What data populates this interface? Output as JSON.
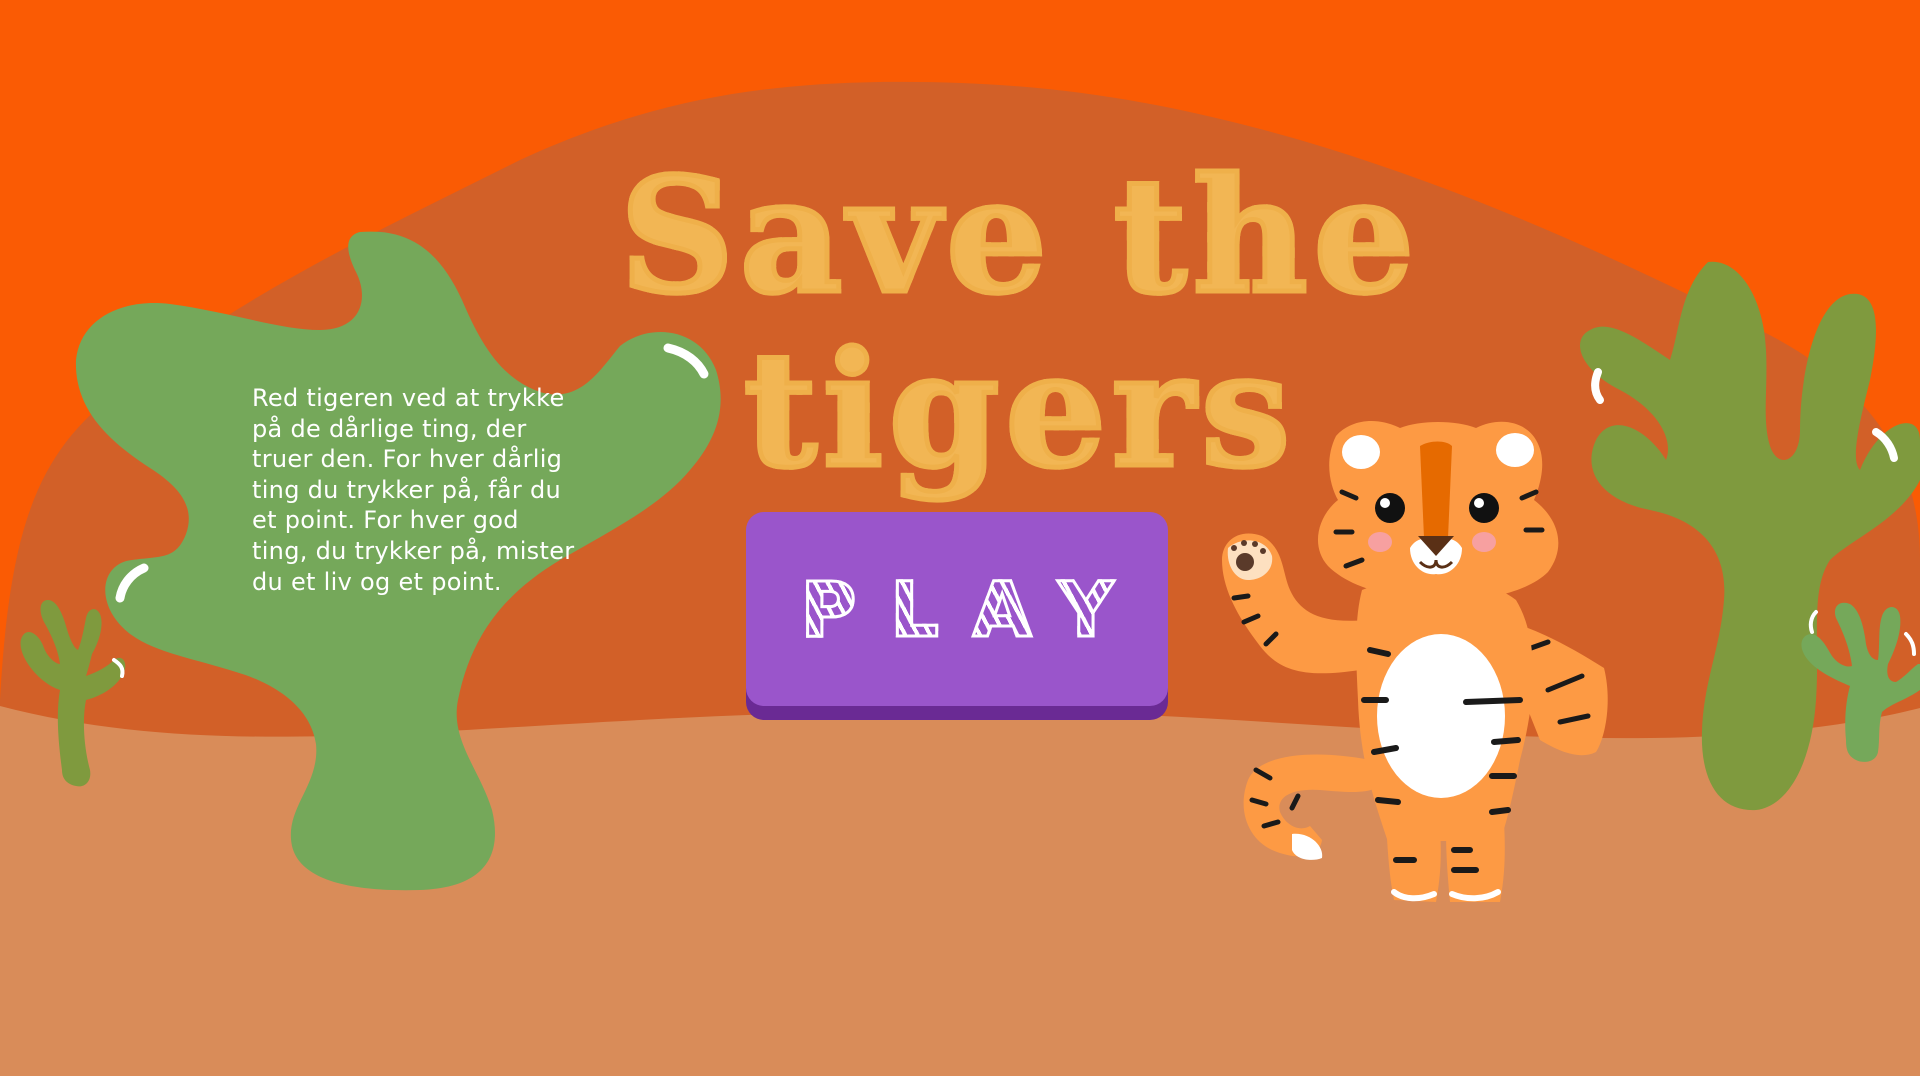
{
  "game": {
    "title": "Save the tigers",
    "instructions": "Red tigeren ved at trykke på de dårlige ting, der truer den. For hver dårlig ting du trykker på, får du et point. For hver god ting, du trykker på, mister du et liv og et point.",
    "play_label": "PLAY"
  },
  "colors": {
    "sky": "#fa5b04",
    "hill": "#d26028",
    "ground": "#d98c59",
    "cactus_light": "#75a85a",
    "cactus_dark": "#7f9a3e",
    "title": "#f2b654",
    "play_button": "#9a55cb",
    "play_button_shadow": "#6a2a94",
    "tiger_orange": "#fd9a44"
  },
  "icons": {
    "tiger": "tiger-mascot-icon",
    "cactus": "cactus-icon"
  }
}
